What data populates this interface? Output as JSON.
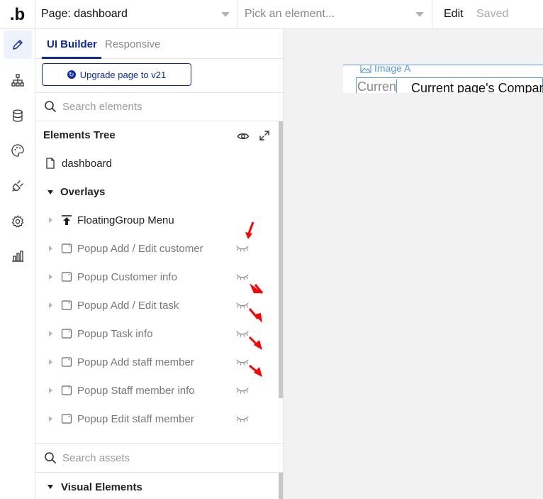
{
  "topbar": {
    "logo": ".b",
    "page_select": "Page: dashboard",
    "element_select_placeholder": "Pick an element...",
    "edit": "Edit",
    "saved": "Saved"
  },
  "rail": {
    "items": [
      {
        "icon": "pencil-icon",
        "active": true
      },
      {
        "icon": "sitemap-icon",
        "active": false
      },
      {
        "icon": "database-icon",
        "active": false
      },
      {
        "icon": "palette-icon",
        "active": false
      },
      {
        "icon": "plug-icon",
        "active": false
      },
      {
        "icon": "gear-icon",
        "active": false
      },
      {
        "icon": "bar-chart-icon",
        "active": false
      }
    ]
  },
  "panel": {
    "tabs": [
      "UI Builder",
      "Responsive"
    ],
    "upgrade_button": "Upgrade page to v21",
    "search_elements_placeholder": "Search elements",
    "tree_header": "Elements Tree",
    "tree": [
      {
        "label": "dashboard",
        "icon": "page-icon",
        "expand": "none",
        "muted": false,
        "eye": false
      },
      {
        "label": "Overlays",
        "icon": "none",
        "expand": "down",
        "muted": false,
        "eye": false
      },
      {
        "label": "FloatingGroup Menu",
        "icon": "floating-group-icon",
        "expand": "right",
        "muted": false,
        "eye": false
      },
      {
        "label": "Popup Add / Edit customer",
        "icon": "popup-icon",
        "expand": "right",
        "muted": true,
        "eye": true
      },
      {
        "label": "Popup Customer info",
        "icon": "popup-icon",
        "expand": "right",
        "muted": true,
        "eye": true
      },
      {
        "label": "Popup Add / Edit task",
        "icon": "popup-icon",
        "expand": "right",
        "muted": true,
        "eye": true
      },
      {
        "label": "Popup Task info",
        "icon": "popup-icon",
        "expand": "right",
        "muted": true,
        "eye": true
      },
      {
        "label": "Popup Add staff member",
        "icon": "popup-icon",
        "expand": "right",
        "muted": true,
        "eye": true
      },
      {
        "label": "Popup Staff member info",
        "icon": "popup-icon",
        "expand": "right",
        "muted": true,
        "eye": true
      },
      {
        "label": "Popup Edit staff member",
        "icon": "popup-icon",
        "expand": "right",
        "muted": true,
        "eye": true
      }
    ],
    "search_assets_placeholder": "Search assets",
    "visual_elements_header": "Visual Elements"
  },
  "canvas": {
    "image_label": "Image A",
    "current_small": "Current page's Company",
    "current_big": "Current page's Compan"
  },
  "colors": {
    "accent": "#0c29ab",
    "canvas_bg": "#f2f2f2",
    "selection": "#5d9ad8",
    "annotation": "#ff0000"
  }
}
